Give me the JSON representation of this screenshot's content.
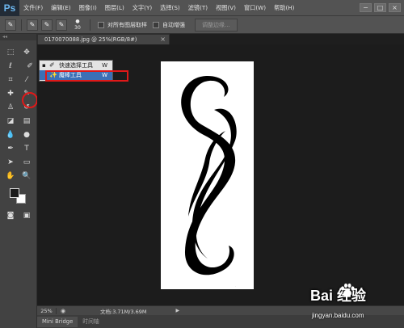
{
  "app": {
    "logo": "Ps",
    "window_buttons": [
      "−",
      "□",
      "×"
    ]
  },
  "menu": {
    "items": [
      "文件(F)",
      "编辑(E)",
      "图像(I)",
      "图层(L)",
      "文字(Y)",
      "选择(S)",
      "滤镜(T)",
      "视图(V)",
      "窗口(W)",
      "帮助(H)"
    ]
  },
  "options_bar": {
    "brush_size": "30",
    "sample_all_layers_label": "对所有图层取样",
    "auto_enhance_label": "自动增强",
    "refine_edge_label": "调整边缘..."
  },
  "document": {
    "tab_title": "0170070088.jpg @ 25%(RGB/8#)",
    "tab_close": "×"
  },
  "flyout": {
    "items": [
      {
        "label": "快速选择工具",
        "shortcut": "W",
        "icon": "quick-selection-icon",
        "current": true
      },
      {
        "label": "魔棒工具",
        "shortcut": "W",
        "icon": "magic-wand-icon",
        "selected": true
      }
    ]
  },
  "status_bar": {
    "zoom": "25%",
    "doc_info": "文档:3.71M/3.69M",
    "arrow": "▶"
  },
  "bottom_tabs": {
    "items": [
      "Mini Bridge",
      "时间轴"
    ]
  },
  "watermark": {
    "brand": "Bai  经验",
    "url": "jingyan.baidu.com"
  },
  "colors": {
    "menubar": "#535353",
    "canvas_bg": "#1c1c1c",
    "highlight_red": "#e01818",
    "selection_blue": "#3b70b7"
  }
}
